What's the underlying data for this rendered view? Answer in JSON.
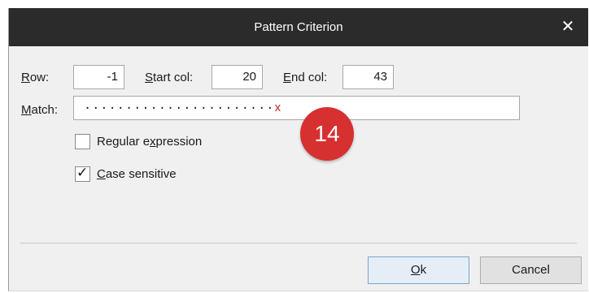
{
  "dialog": {
    "title": "Pattern Criterion",
    "close_glyph": "✕"
  },
  "row": {
    "mnemonic": "R",
    "rest": "ow:",
    "value": "-1"
  },
  "start_col": {
    "mnemonic": "S",
    "rest": "tart col:",
    "value": "20"
  },
  "end_col": {
    "mnemonic": "E",
    "rest": "nd col:",
    "value": "43"
  },
  "match": {
    "mnemonic": "M",
    "rest": "atch:",
    "value_dots": "·······················",
    "value_end": "x"
  },
  "options": {
    "regex": {
      "label_pre": "Regular e",
      "mnemonic": "x",
      "label_post": "pression",
      "checked": false
    },
    "case_sensitive": {
      "mnemonic": "C",
      "label_post": "ase sensitive",
      "checked": true,
      "check_glyph": "✓"
    }
  },
  "badge": {
    "text": "14",
    "color": "#d63031"
  },
  "buttons": {
    "ok": {
      "mnemonic": "O",
      "rest": "k"
    },
    "cancel": {
      "label": "Cancel"
    }
  },
  "colors": {
    "titlebar": "#2b2b2b",
    "body": "#f0f0f0",
    "accent": "#c42b2b"
  },
  "icons": {
    "close": "close-icon",
    "check": "checkmark-icon"
  }
}
